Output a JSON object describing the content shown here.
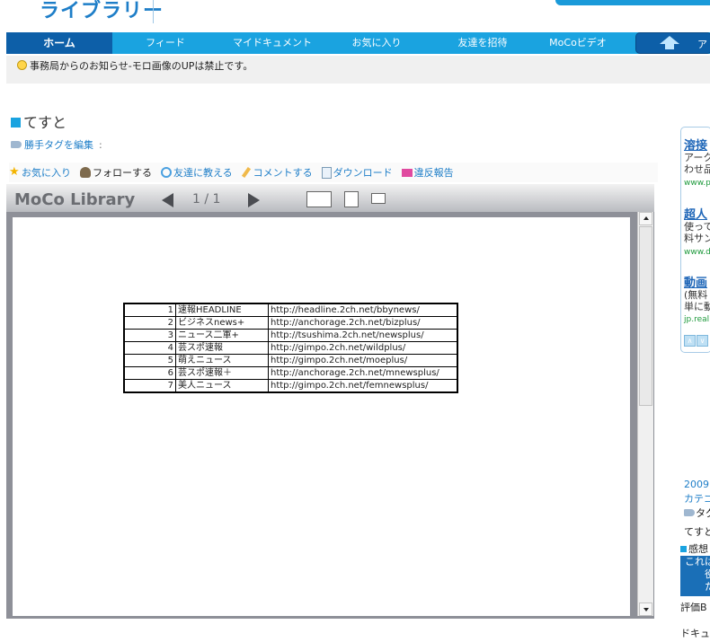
{
  "header": {
    "logo_text": "ライブラリー"
  },
  "nav": {
    "items": [
      "ホーム",
      "フィード",
      "マイドキュメント",
      "お気に入り",
      "友達を招待",
      "MoCoビデオ"
    ],
    "upload_label": "ア"
  },
  "notice": {
    "text": "事務局からのお知らせ-モロ画像のUPは禁止です。"
  },
  "document": {
    "title": "てすと",
    "tag_edit": "勝手タグを編集",
    "tag_colon": ":"
  },
  "actions": [
    "お気に入り",
    "フォローする",
    "友達に教える",
    "コメントする",
    "ダウンロード",
    "違反報告"
  ],
  "viewer": {
    "title": "MoCo Library",
    "page_indicator": "1 / 1"
  },
  "table_rows": [
    {
      "num": "1",
      "name": "速報HEADLINE",
      "url": "http://headline.2ch.net/bbynews/"
    },
    {
      "num": "2",
      "name": "ビジネスnews+",
      "url": "http://anchorage.2ch.net/bizplus/"
    },
    {
      "num": "3",
      "name": "ニュース二軍+",
      "url": "http://tsushima.2ch.net/newsplus/"
    },
    {
      "num": "4",
      "name": "芸スポ速報",
      "url": "http://gimpo.2ch.net/wildplus/"
    },
    {
      "num": "5",
      "name": "萌えニュース",
      "url": "http://gimpo.2ch.net/moeplus/"
    },
    {
      "num": "6",
      "name": "芸スポ速報＋",
      "url": "http://anchorage.2ch.net/mnewsplus/"
    },
    {
      "num": "7",
      "name": "美人ニュース",
      "url": "http://gimpo.2ch.net/femnewsplus/"
    }
  ],
  "ads": [
    {
      "title": "溶接",
      "line1": "アーク",
      "line2": "わせ品",
      "url": "www.p"
    },
    {
      "title": "超人",
      "line1": "使って",
      "line2": "料サン",
      "url": "www.d"
    },
    {
      "title": "動画",
      "line1": "(無料",
      "line2": "単に動",
      "url": "jp.real"
    }
  ],
  "ad_nav": [
    "∧",
    "∨"
  ],
  "right_meta": {
    "date": "2009",
    "category": "カテゴ",
    "tag": "タグ",
    "title_short": "てすと",
    "section": "感想",
    "box_line1": "これは",
    "box_line2": "役",
    "box_line3": "た",
    "rating": "評価B",
    "doc_label": "ドキュメ"
  }
}
